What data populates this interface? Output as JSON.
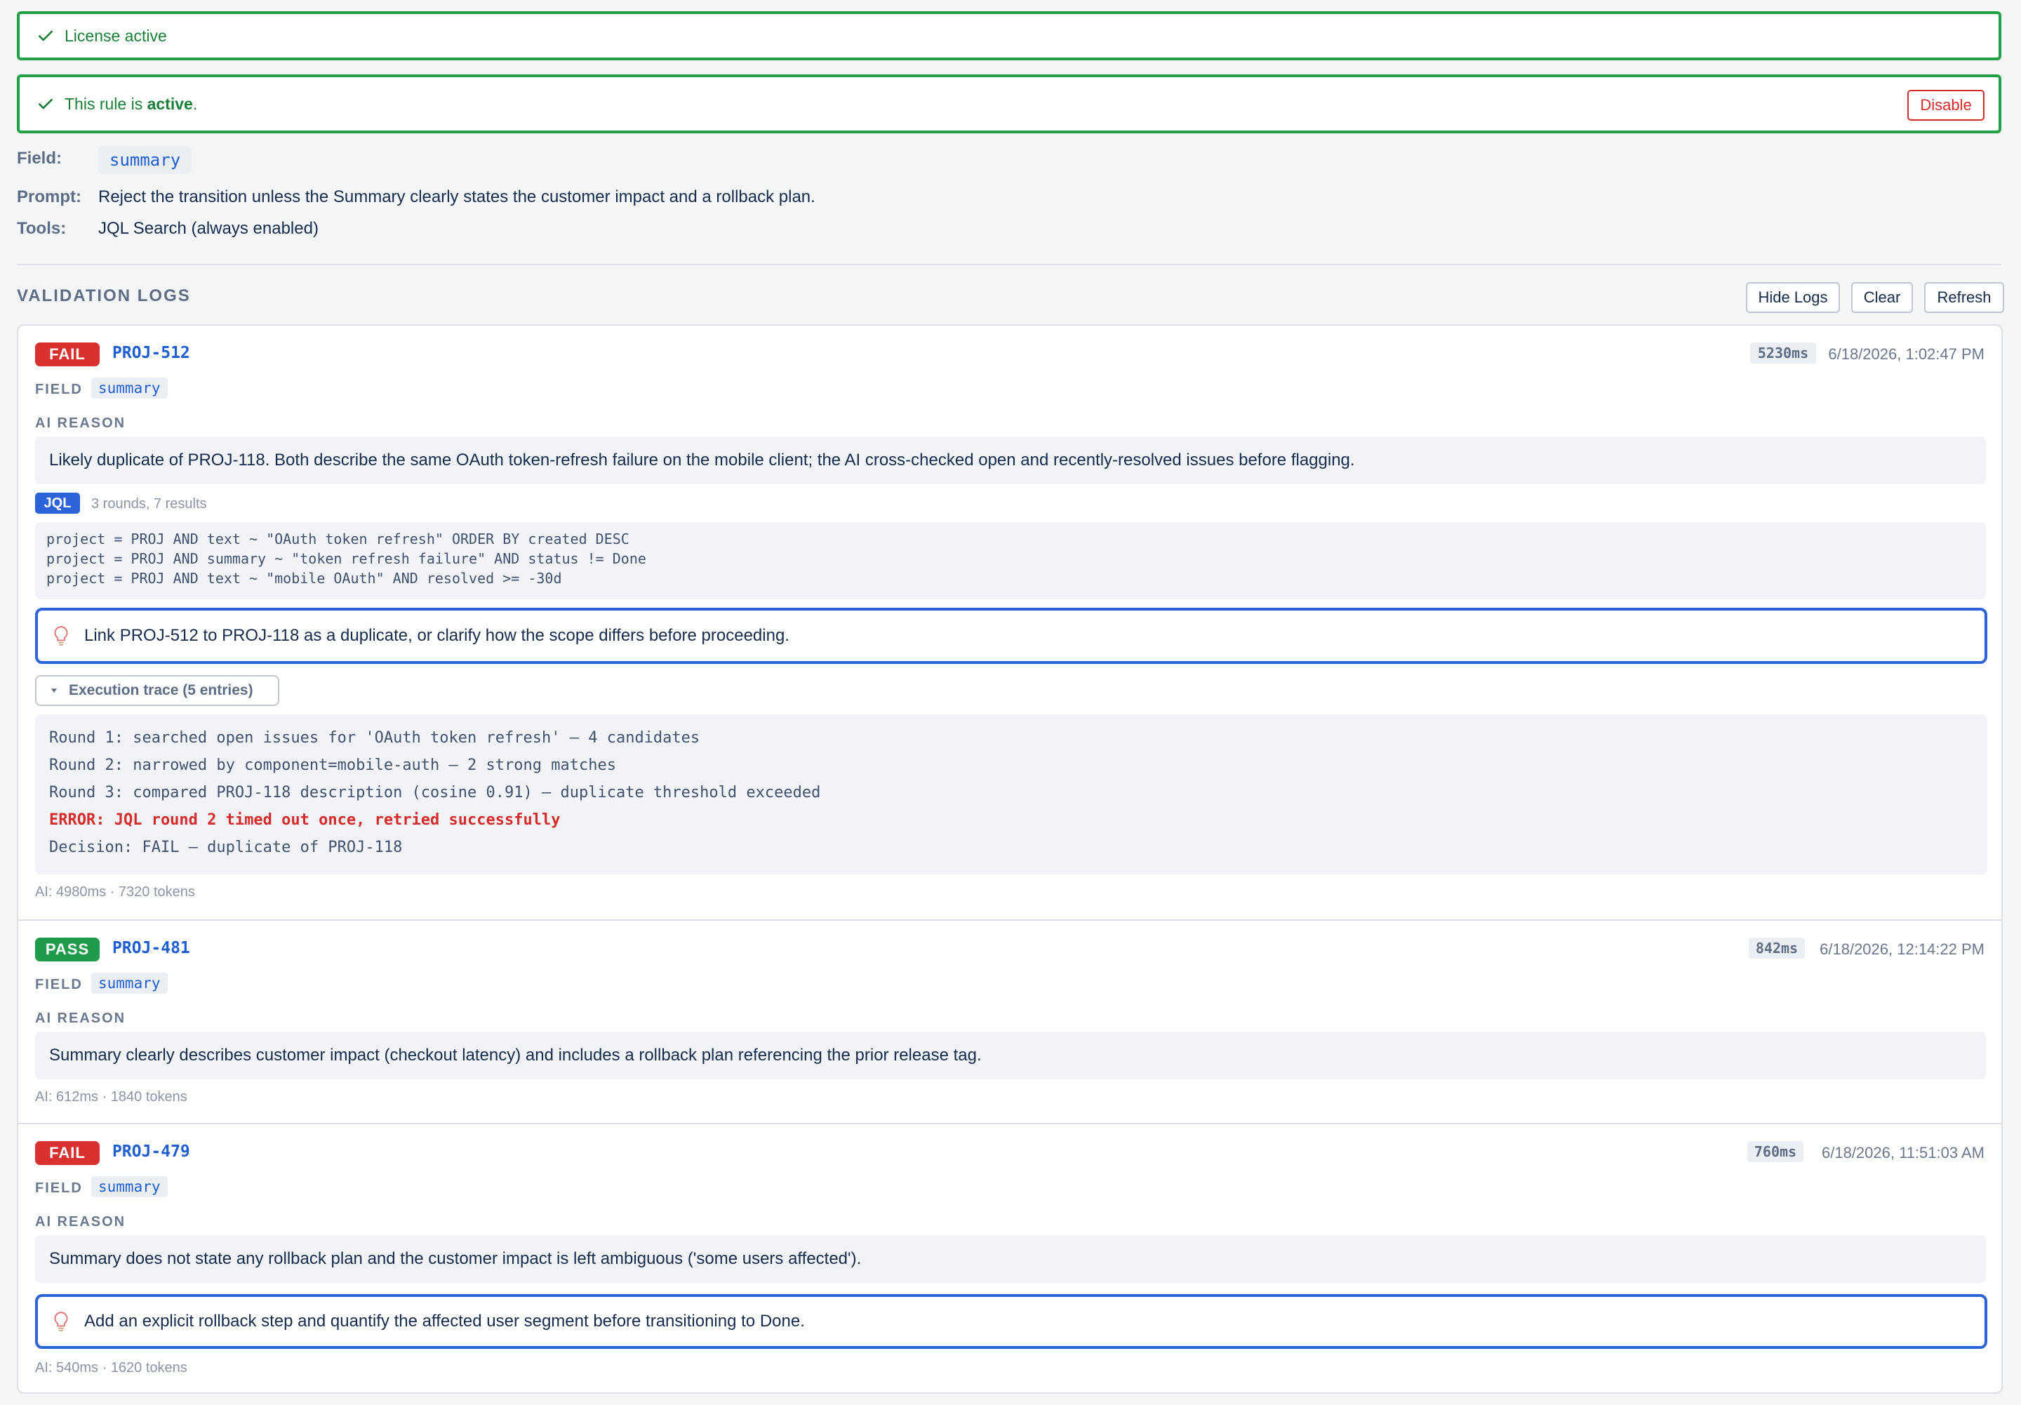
{
  "banners": {
    "license": "License active",
    "rule_prefix": "This rule is ",
    "rule_status": "active",
    "rule_suffix": ".",
    "disable_label": "Disable"
  },
  "rule": {
    "field_label": "Field:",
    "field_value": "summary",
    "prompt_label": "Prompt:",
    "prompt_value": "Reject the transition unless the Summary clearly states the customer impact and a rollback plan.",
    "tools_label": "Tools:",
    "tools_value": "JQL Search (always enabled)"
  },
  "logs_section": {
    "title": "VALIDATION LOGS",
    "hide_label": "Hide Logs",
    "clear_label": "Clear",
    "refresh_label": "Refresh"
  },
  "labels": {
    "field": "FIELD",
    "ai_reason": "AI REASON",
    "jql": "JQL"
  },
  "entries": [
    {
      "status": "FAIL",
      "issue": "PROJ-512",
      "duration": "5230ms",
      "timestamp": "6/18/2026, 1:02:47 PM",
      "field": "summary",
      "reason": "Likely duplicate of PROJ-118. Both describe the same OAuth token-refresh failure on the mobile client; the AI cross-checked open and recently-resolved issues before flagging.",
      "jql_meta": "3 rounds, 7 results",
      "jql_queries": [
        "project = PROJ AND text ~ \"OAuth token refresh\" ORDER BY created DESC",
        "project = PROJ AND summary ~ \"token refresh failure\" AND status != Done",
        "project = PROJ AND text ~ \"mobile OAuth\" AND resolved >= -30d"
      ],
      "hint": "Link PROJ-512 to PROJ-118 as a duplicate, or clarify how the scope differs before proceeding.",
      "trace_label": "Execution trace (5 entries)",
      "trace": [
        "Round 1: searched open issues for 'OAuth token refresh' — 4 candidates",
        "Round 2: narrowed by component=mobile-auth — 2 strong matches",
        "Round 3: compared PROJ-118 description (cosine 0.91) — duplicate threshold exceeded",
        "ERROR: JQL round 2 timed out once, retried successfully",
        "Decision: FAIL — duplicate of PROJ-118"
      ],
      "footer": "AI: 4980ms · 7320 tokens"
    },
    {
      "status": "PASS",
      "issue": "PROJ-481",
      "duration": "842ms",
      "timestamp": "6/18/2026, 12:14:22 PM",
      "field": "summary",
      "reason": "Summary clearly describes customer impact (checkout latency) and includes a rollback plan referencing the prior release tag.",
      "footer": "AI: 612ms · 1840 tokens"
    },
    {
      "status": "FAIL",
      "issue": "PROJ-479",
      "duration": "760ms",
      "timestamp": "6/18/2026, 11:51:03 AM",
      "field": "summary",
      "reason": "Summary does not state any rollback plan and the customer impact is left ambiguous ('some users affected').",
      "hint": "Add an explicit rollback step and quantify the affected user segment before transitioning to Done.",
      "footer": "AI: 540ms · 1620 tokens"
    }
  ]
}
